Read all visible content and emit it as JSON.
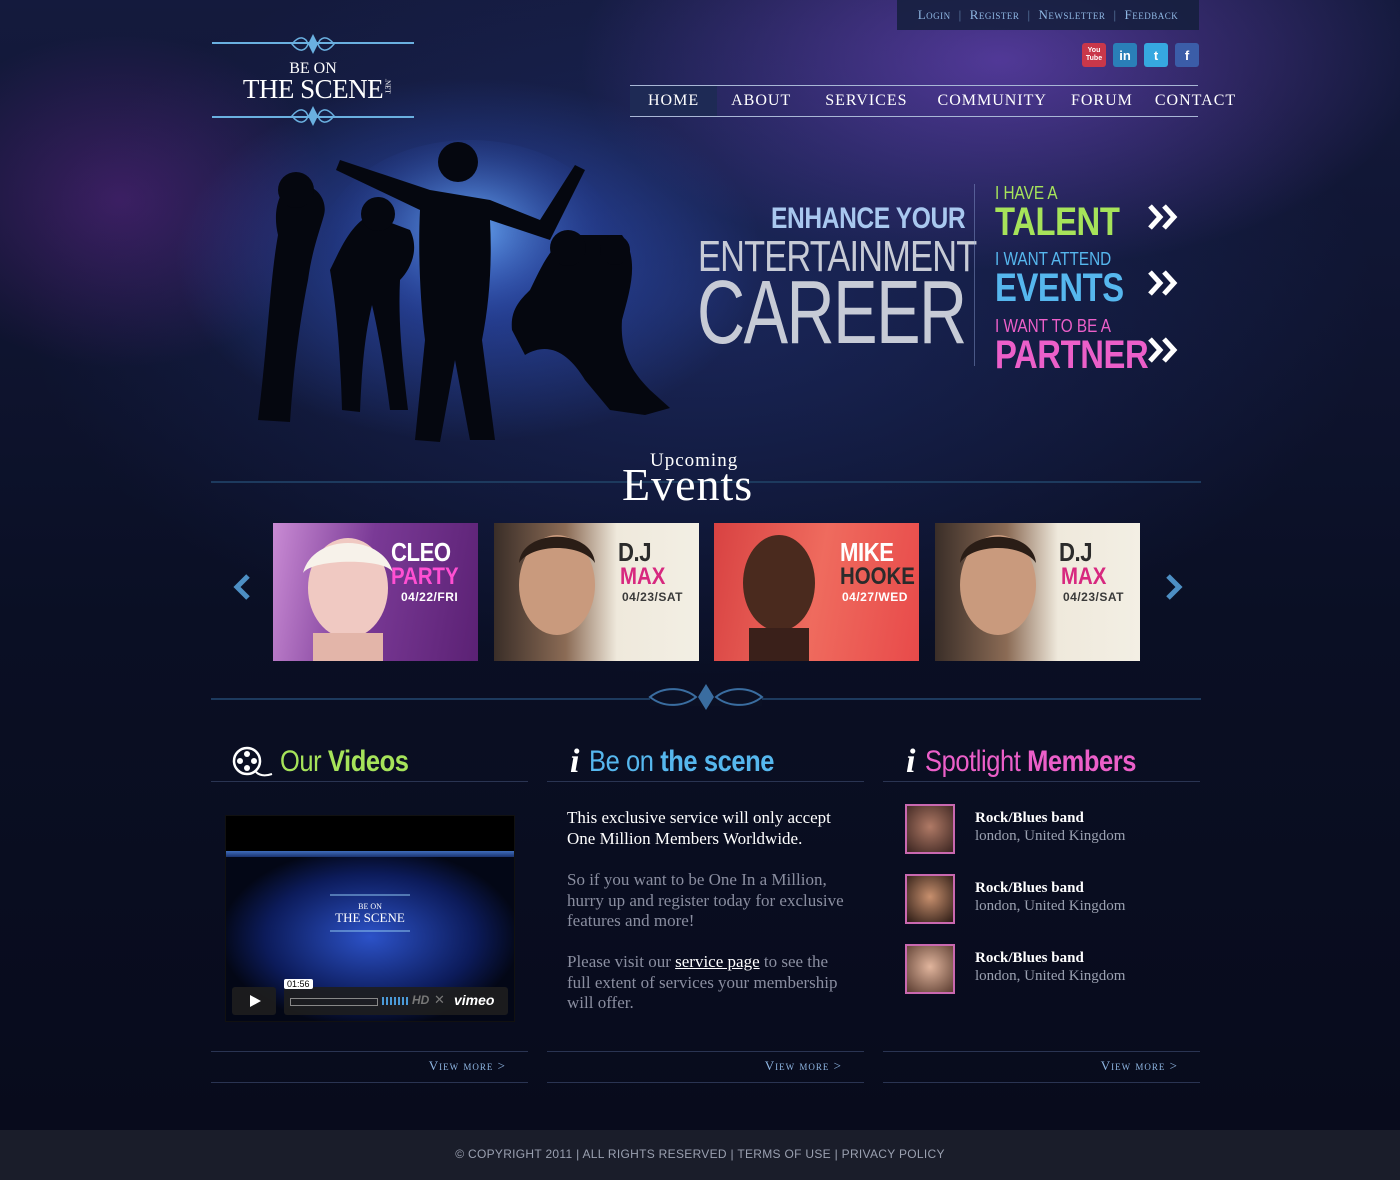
{
  "topbar": {
    "login": "Login",
    "register": "Register",
    "newsletter": "Newsletter",
    "feedback": "Feedback"
  },
  "logo": {
    "line1": "BE ON",
    "line2": "THE SCENE",
    "suffix": ".NET"
  },
  "social": {
    "youtube": "You Tube",
    "linkedin": "in",
    "twitter": "t",
    "facebook": "f"
  },
  "nav": {
    "home": "Home",
    "about": "About",
    "services": "Services",
    "community": "Community",
    "forum": "Forum",
    "contact": "Contact"
  },
  "hero": {
    "line1": "ENHANCE YOUR",
    "line2": "ENTERTAINMENT",
    "line3": "CAREER",
    "cta": [
      {
        "small": "I HAVE A",
        "big": "TALENT",
        "color": "#a6e35a"
      },
      {
        "small": "I WANT ATTEND",
        "big": "EVENTS",
        "color": "#56b7ee"
      },
      {
        "small": "I WANT TO BE A",
        "big": "PARTNER",
        "color": "#ec5fc9"
      }
    ]
  },
  "events": {
    "title_small": "Upcoming",
    "title_big": "Events",
    "cards": [
      {
        "name": "CLEO",
        "sub": "PARTY",
        "date": "04/22/FRI",
        "bg": "#6a2f86",
        "sub_color": "#ff4fd2",
        "name_color": "#ffffff"
      },
      {
        "name": "D.J",
        "sub": "MAX",
        "date": "04/23/SAT",
        "bg": "#e9e4d6",
        "sub_color": "#d7287f",
        "name_color": "#2b2b2b"
      },
      {
        "name": "MIKE",
        "sub": "HOOKE",
        "date": "04/27/WED",
        "bg": "#e34a4a",
        "sub_color": "#2b2b2b",
        "name_color": "#ffffff"
      },
      {
        "name": "D.J",
        "sub": "MAX",
        "date": "04/23/SAT",
        "bg": "#e9e4d6",
        "sub_color": "#d7287f",
        "name_color": "#2b2b2b"
      }
    ]
  },
  "videos": {
    "title_light": "Our",
    "title_bold": "Videos",
    "color": "#a6e35a",
    "time": "01:56",
    "brand": "vimeo",
    "hd": "HD",
    "view_more": "View more >"
  },
  "scene": {
    "title_light": "Be on",
    "title_bold": "the scene",
    "color": "#56b7ee",
    "p1": "This exclusive service will only accept One Million Members Worldwide.",
    "p2": "So if you want to be One In a Million, hurry up and register today for exclusive features and more!",
    "p3_before": "Please visit our",
    "p3_link": "service page",
    "p3_after": "to see the full extent of services your membership will offer.",
    "view_more": "View more >"
  },
  "members": {
    "title_light": "Spotlight",
    "title_bold": "Members",
    "color": "#ec5fc9",
    "items": [
      {
        "name": "Rock/Blues band",
        "location": "london, United Kingdom"
      },
      {
        "name": "Rock/Blues band",
        "location": "london, United Kingdom"
      },
      {
        "name": "Rock/Blues band",
        "location": "london, United Kingdom"
      }
    ],
    "view_more": "View more >"
  },
  "footer": {
    "text": "© COPYRIGHT 2011 | ALL RIGHTS RESERVED | TERMS OF USE | PRIVACY POLICY"
  }
}
